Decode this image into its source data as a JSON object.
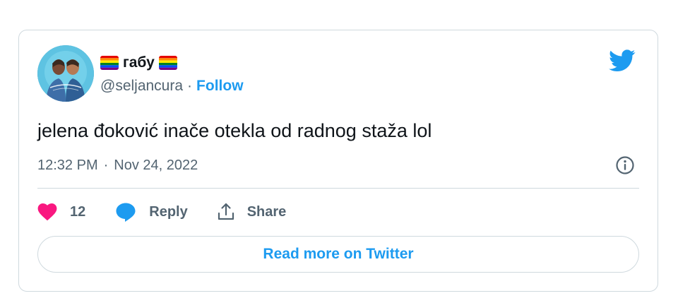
{
  "tweet": {
    "display_name": "габу",
    "handle": "@seljancura",
    "separator": "·",
    "follow_label": "Follow",
    "text": "jelena đoković inače otekla od radnog staža lol",
    "time": "12:32 PM",
    "date": "Nov 24, 2022",
    "like_count": "12",
    "reply_label": "Reply",
    "share_label": "Share",
    "read_more_label": "Read more on Twitter"
  },
  "icons": {
    "logo": "twitter-bird-icon",
    "info": "info-icon",
    "like": "heart-icon",
    "reply": "speech-bubble-icon",
    "share": "share-upload-icon",
    "flag": "rainbow-flag-icon"
  },
  "colors": {
    "accent": "#1d9bf0",
    "like": "#f91880",
    "text_primary": "#0f1419",
    "text_secondary": "#536471",
    "border": "#cfd9de"
  }
}
